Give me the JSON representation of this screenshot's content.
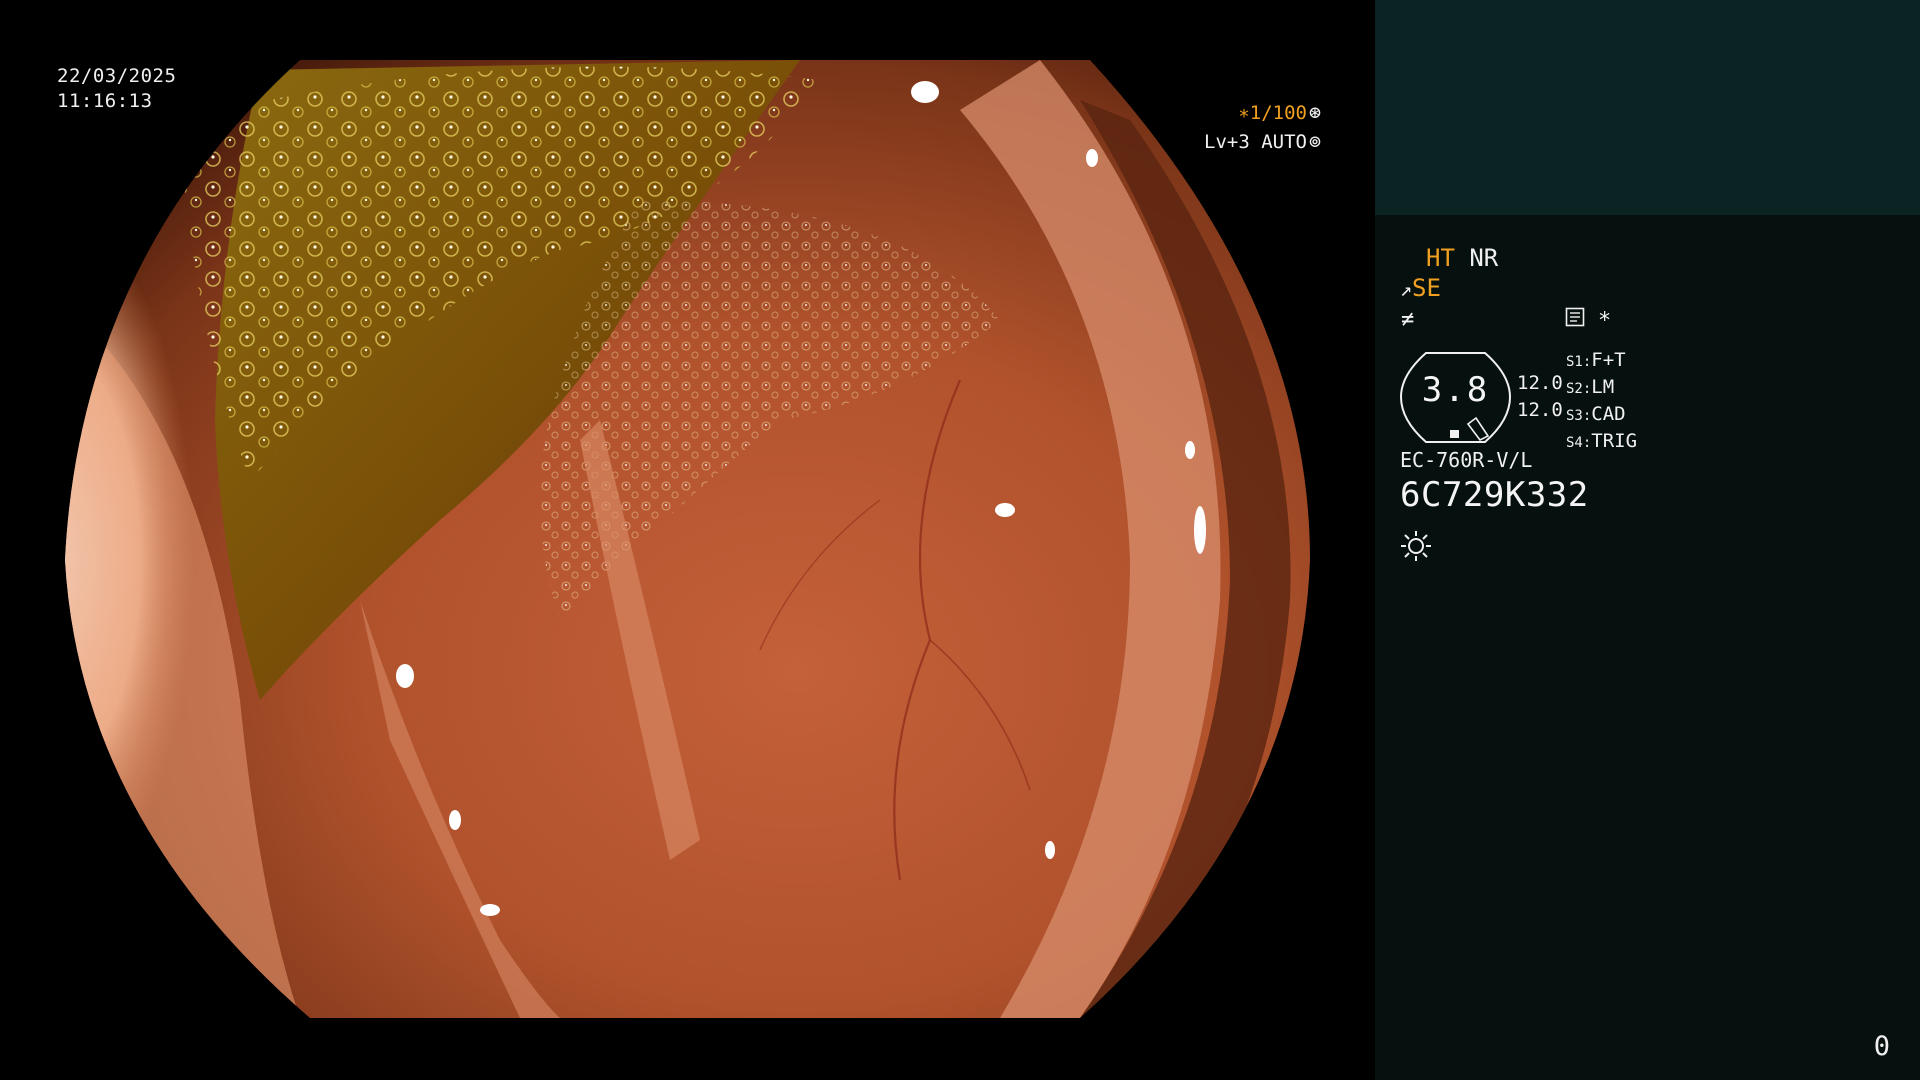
{
  "overlay": {
    "date": "22/03/2025",
    "time": "11:16:13",
    "shutter": "∗1/100",
    "shutter_icon": "aperture-icon",
    "level": "Lv+3 AUTO",
    "level_icon": "iris-icon"
  },
  "panel": {
    "ht": "HT",
    "nr": "NR",
    "se": "SE",
    "star": "∗",
    "center_value": "3.8",
    "scale_top": "12.0",
    "scale_bottom": "12.0",
    "switches": [
      {
        "label": "S1:",
        "value": "F+T"
      },
      {
        "label": "S2:",
        "value": "LM"
      },
      {
        "label": "S3:",
        "value": "CAD"
      },
      {
        "label": "S4:",
        "value": "TRIG"
      }
    ],
    "model": "EC-760R-V/L",
    "serial": "6C729K332",
    "counter": "0"
  },
  "colors": {
    "highlight": "#f0a020",
    "panel_header": "#0c2323",
    "panel_body": "#06110f"
  }
}
